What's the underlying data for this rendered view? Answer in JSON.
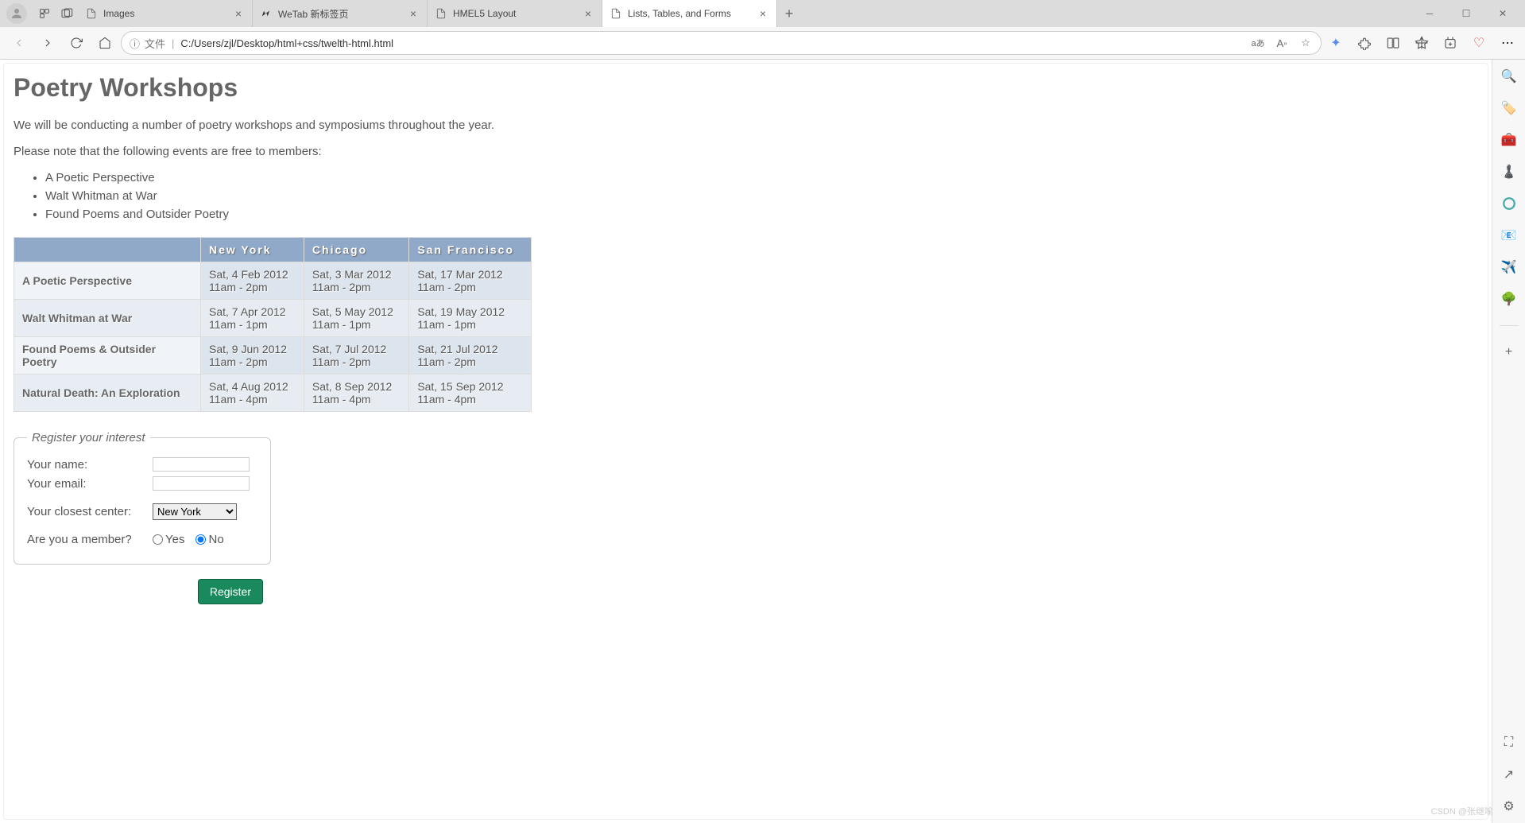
{
  "browser": {
    "tabs": [
      {
        "title": "Images",
        "active": false
      },
      {
        "title": "WeTab 新标签页",
        "active": false
      },
      {
        "title": "HMEL5 Layout",
        "active": false
      },
      {
        "title": "Lists, Tables, and Forms",
        "active": true
      }
    ],
    "address": {
      "prefix": "文件",
      "url": "C:/Users/zjl/Desktop/html+css/twelth-html.html"
    }
  },
  "page": {
    "title": "Poetry Workshops",
    "intro1": "We will be conducting a number of poetry workshops and symposiums throughout the year.",
    "intro2": "Please note that the following events are free to members:",
    "free_events": [
      "A Poetic Perspective",
      "Walt Whitman at War",
      "Found Poems and Outsider Poetry"
    ],
    "table": {
      "headers": [
        "",
        "New York",
        "Chicago",
        "San Francisco"
      ],
      "rows": [
        {
          "name": "A Poetic Perspective",
          "ny_date": "Sat, 4 Feb 2012",
          "ny_time": "11am - 2pm",
          "ch_date": "Sat, 3 Mar 2012",
          "ch_time": "11am - 2pm",
          "sf_date": "Sat, 17 Mar 2012",
          "sf_time": "11am - 2pm"
        },
        {
          "name": "Walt Whitman at War",
          "ny_date": "Sat, 7 Apr 2012",
          "ny_time": "11am - 1pm",
          "ch_date": "Sat, 5 May 2012",
          "ch_time": "11am - 1pm",
          "sf_date": "Sat, 19 May 2012",
          "sf_time": "11am - 1pm"
        },
        {
          "name": "Found Poems & Outsider Poetry",
          "ny_date": "Sat, 9 Jun 2012",
          "ny_time": "11am - 2pm",
          "ch_date": "Sat, 7 Jul 2012",
          "ch_time": "11am - 2pm",
          "sf_date": "Sat, 21 Jul 2012",
          "sf_time": "11am - 2pm"
        },
        {
          "name": "Natural Death: An Exploration",
          "ny_date": "Sat, 4 Aug 2012",
          "ny_time": "11am - 4pm",
          "ch_date": "Sat, 8 Sep 2012",
          "ch_time": "11am - 4pm",
          "sf_date": "Sat, 15 Sep 2012",
          "sf_time": "11am - 4pm"
        }
      ]
    },
    "form": {
      "legend": "Register your interest",
      "name_label": "Your name:",
      "email_label": "Your email:",
      "center_label": "Your closest center:",
      "center_selected": "New York",
      "member_label": "Are you a member?",
      "yes_label": "Yes",
      "no_label": "No",
      "submit_label": "Register"
    }
  },
  "watermark": "CSDN @张继喻"
}
